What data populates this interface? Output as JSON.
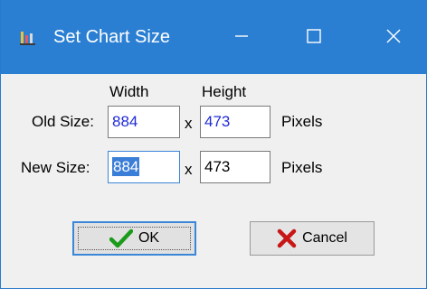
{
  "window": {
    "title": "Set Chart Size",
    "icon": "chart-icon"
  },
  "titlebar_buttons": {
    "minimize_icon": "minimize-icon",
    "maximize_icon": "maximize-icon",
    "close_icon": "close-icon"
  },
  "columns": {
    "width_label": "Width",
    "height_label": "Height"
  },
  "old_size": {
    "label": "Old Size:",
    "width": "884",
    "separator": "x",
    "height": "473",
    "unit": "Pixels",
    "value_color": "#1f2bd6"
  },
  "new_size": {
    "label": "New Size:",
    "width": "884",
    "separator": "x",
    "height": "473",
    "unit": "Pixels"
  },
  "buttons": {
    "ok_label": "OK",
    "ok_icon": "checkmark-icon",
    "cancel_label": "Cancel",
    "cancel_icon": "x-mark-icon"
  },
  "colors": {
    "titlebar": "#2b7fd3",
    "accent": "#3b86d9",
    "ok_check": "#1a9b1a",
    "cancel_x": "#c81616"
  }
}
